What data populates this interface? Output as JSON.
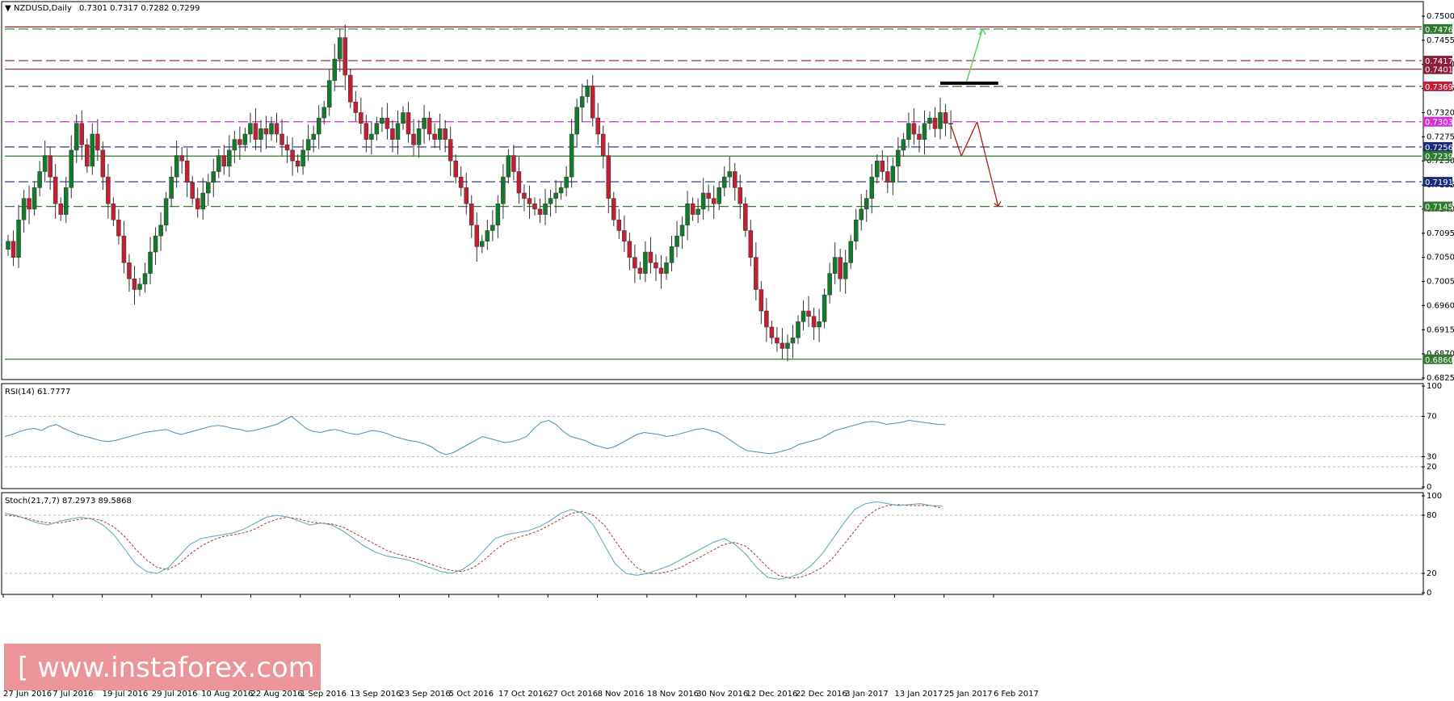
{
  "header": {
    "title": "NZDUSD,Daily",
    "ohlc": "0.7301 0.7317 0.7282 0.7299"
  },
  "rsi_panel": {
    "label": "RSI(14) 61.7777",
    "levels": [
      100,
      70,
      30,
      20,
      0
    ],
    "tick_labels": [
      "100",
      "70",
      "30",
      "20",
      "0"
    ]
  },
  "stoch_panel": {
    "label": "Stoch(21,7,7) 87.2973 89.5868",
    "levels": [
      100,
      80,
      20,
      0
    ],
    "tick_labels": [
      "100",
      "80",
      "20",
      "0"
    ]
  },
  "watermark": {
    "text": "[ www.instaforex.com ]"
  },
  "colors": {
    "bull": "#127a2a",
    "bear": "#c21f35",
    "wick": "#333333",
    "rsi": "#4b8fb3",
    "stoch_main": "#58a6b8",
    "stoch_signal": "#a63a3a",
    "magenta": "#d42fd4",
    "navy": "#1c2a7a",
    "dark_green": "#2e7a2e",
    "maroon": "#8a1e3a",
    "arrow_green": "#5fd05f",
    "arrow_red": "#b01c1c",
    "watermark_bg": "#e98a8f"
  },
  "chart_data": {
    "type": "candlestick",
    "symbol": "NZDUSD",
    "timeframe": "Daily",
    "ylim": [
      0.6825,
      0.75
    ],
    "y_ticks": [
      "0.7500",
      "0.7455",
      "0.7410",
      "0.7365",
      "0.7320",
      "0.7275",
      "0.7230",
      "0.7185",
      "0.7140",
      "0.7095",
      "0.7050",
      "0.7005",
      "0.6960",
      "0.6915",
      "0.6870",
      "0.6825"
    ],
    "x_tick_labels": [
      "27 Jun 2016",
      "7 Jul 2016",
      "19 Jul 2016",
      "29 Jul 2016",
      "10 Aug 2016",
      "22 Aug 2016",
      "1 Sep 2016",
      "13 Sep 2016",
      "23 Sep 2016",
      "5 Oct 2016",
      "17 Oct 2016",
      "27 Oct 2016",
      "8 Nov 2016",
      "18 Nov 2016",
      "30 Nov 2016",
      "12 Dec 2016",
      "22 Dec 2016",
      "3 Jan 2017",
      "13 Jan 2017",
      "25 Jan 2017",
      "6 Feb 2017"
    ],
    "closes": [
      0.708,
      0.705,
      0.712,
      0.716,
      0.714,
      0.718,
      0.721,
      0.724,
      0.72,
      0.715,
      0.713,
      0.718,
      0.725,
      0.73,
      0.726,
      0.722,
      0.728,
      0.725,
      0.72,
      0.715,
      0.712,
      0.709,
      0.704,
      0.701,
      0.699,
      0.7,
      0.702,
      0.706,
      0.709,
      0.711,
      0.716,
      0.72,
      0.724,
      0.723,
      0.719,
      0.716,
      0.714,
      0.717,
      0.719,
      0.721,
      0.724,
      0.722,
      0.725,
      0.727,
      0.726,
      0.728,
      0.73,
      0.727,
      0.729,
      0.728,
      0.73,
      0.728,
      0.726,
      0.725,
      0.723,
      0.722,
      0.725,
      0.727,
      0.728,
      0.731,
      0.733,
      0.738,
      0.742,
      0.746,
      0.739,
      0.734,
      0.732,
      0.73,
      0.727,
      0.728,
      0.73,
      0.731,
      0.729,
      0.727,
      0.73,
      0.732,
      0.728,
      0.726,
      0.729,
      0.731,
      0.728,
      0.727,
      0.729,
      0.727,
      0.723,
      0.72,
      0.718,
      0.715,
      0.711,
      0.707,
      0.708,
      0.71,
      0.711,
      0.715,
      0.72,
      0.724,
      0.721,
      0.717,
      0.716,
      0.715,
      0.714,
      0.713,
      0.715,
      0.716,
      0.717,
      0.718,
      0.72,
      0.728,
      0.733,
      0.735,
      0.737,
      0.731,
      0.728,
      0.724,
      0.716,
      0.712,
      0.71,
      0.708,
      0.705,
      0.703,
      0.702,
      0.706,
      0.704,
      0.703,
      0.702,
      0.704,
      0.707,
      0.709,
      0.711,
      0.715,
      0.713,
      0.714,
      0.717,
      0.716,
      0.715,
      0.718,
      0.72,
      0.721,
      0.718,
      0.715,
      0.71,
      0.705,
      0.699,
      0.695,
      0.692,
      0.69,
      0.689,
      0.688,
      0.689,
      0.69,
      0.693,
      0.695,
      0.694,
      0.692,
      0.693,
      0.698,
      0.702,
      0.705,
      0.701,
      0.704,
      0.708,
      0.712,
      0.714,
      0.716,
      0.72,
      0.723,
      0.721,
      0.719,
      0.722,
      0.725,
      0.727,
      0.73,
      0.728,
      0.727,
      0.73,
      0.731,
      0.729,
      0.732,
      0.73,
      0.7299
    ],
    "horizontal_levels": [
      {
        "price": 0.7476,
        "label": "0.7476",
        "style": "dashed",
        "color": "dark_green",
        "label_bg": "dark_green"
      },
      {
        "price": 0.748,
        "label": "",
        "style": "solid",
        "color": "maroon"
      },
      {
        "price": 0.7417,
        "label": "0.7417",
        "style": "dashed",
        "color": "maroon",
        "label_bg": "maroon"
      },
      {
        "price": 0.7401,
        "label": "0.7401",
        "style": "solid",
        "color": "maroon",
        "label_bg": "maroon"
      },
      {
        "price": 0.7369,
        "label": "0.7369",
        "style": "dashed",
        "color": "wick",
        "label_bg": "bear"
      },
      {
        "price": 0.7303,
        "label": "0.7303",
        "style": "dashed",
        "color": "magenta",
        "label_bg": "magenta"
      },
      {
        "price": 0.7256,
        "label": "0.7256",
        "style": "dashed",
        "color": "navy",
        "label_bg": "navy"
      },
      {
        "price": 0.7239,
        "label": "0.7239",
        "style": "solid",
        "color": "dark_green",
        "label_bg": "dark_green"
      },
      {
        "price": 0.7191,
        "label": "0.7191",
        "style": "dashed",
        "color": "navy",
        "label_bg": "navy"
      },
      {
        "price": 0.7145,
        "label": "0.7145",
        "style": "dashed",
        "color": "dark_green",
        "label_bg": "dark_green"
      },
      {
        "price": 0.686,
        "label": "0.6860",
        "style": "solid",
        "color": "dark_green",
        "label_bg": "dark_green"
      }
    ],
    "resistance_bar": {
      "price": 0.7375,
      "from_index": 177,
      "to_index": 188
    },
    "projection_up": {
      "from": {
        "i": 182,
        "price": 0.7378
      },
      "to": {
        "i": 185,
        "price": 0.7476
      }
    },
    "projection_down": [
      {
        "i": 179,
        "price": 0.7297
      },
      {
        "i": 181,
        "price": 0.7239
      },
      {
        "i": 184,
        "price": 0.7303
      },
      {
        "i": 188,
        "price": 0.7145
      }
    ],
    "rsi": [
      50,
      52,
      55,
      57,
      58,
      56,
      60,
      62,
      58,
      55,
      52,
      50,
      48,
      46,
      45,
      46,
      48,
      50,
      52,
      54,
      55,
      56,
      57,
      54,
      52,
      54,
      56,
      58,
      60,
      61,
      60,
      58,
      57,
      55,
      56,
      58,
      60,
      62,
      66,
      70,
      64,
      58,
      55,
      54,
      56,
      57,
      55,
      53,
      52,
      54,
      56,
      55,
      53,
      50,
      48,
      46,
      45,
      43,
      40,
      35,
      32,
      34,
      38,
      42,
      46,
      50,
      48,
      46,
      44,
      45,
      47,
      50,
      58,
      64,
      66,
      62,
      55,
      50,
      48,
      46,
      42,
      40,
      38,
      40,
      44,
      48,
      52,
      54,
      53,
      52,
      50,
      51,
      53,
      55,
      57,
      58,
      56,
      54,
      50,
      45,
      40,
      36,
      35,
      34,
      33,
      34,
      36,
      38,
      42,
      44,
      46,
      48,
      52,
      56,
      58,
      60,
      62,
      64,
      65,
      64,
      62,
      63,
      64,
      66,
      65,
      64,
      63,
      62,
      61.78
    ],
    "stoch_main": [
      82,
      80,
      76,
      72,
      70,
      74,
      76,
      78,
      76,
      70,
      60,
      45,
      30,
      22,
      20,
      26,
      38,
      50,
      56,
      58,
      60,
      62,
      66,
      72,
      78,
      80,
      78,
      74,
      70,
      72,
      70,
      64,
      56,
      48,
      42,
      38,
      36,
      34,
      30,
      26,
      22,
      20,
      24,
      32,
      44,
      56,
      60,
      62,
      64,
      68,
      74,
      82,
      86,
      82,
      70,
      50,
      30,
      20,
      18,
      20,
      24,
      28,
      34,
      40,
      46,
      52,
      56,
      50,
      40,
      26,
      16,
      14,
      16,
      20,
      28,
      40,
      56,
      72,
      86,
      92,
      94,
      92,
      90,
      91,
      92,
      90,
      89.59
    ],
    "stoch_signal": [
      80,
      79,
      77,
      74,
      72,
      72,
      74,
      76,
      77,
      74,
      68,
      58,
      45,
      34,
      26,
      24,
      30,
      40,
      48,
      54,
      58,
      60,
      62,
      66,
      72,
      76,
      78,
      76,
      73,
      72,
      71,
      68,
      62,
      56,
      50,
      44,
      40,
      37,
      34,
      30,
      26,
      23,
      22,
      26,
      34,
      44,
      52,
      57,
      60,
      64,
      70,
      76,
      82,
      84,
      80,
      70,
      54,
      38,
      26,
      20,
      20,
      22,
      26,
      32,
      38,
      44,
      50,
      52,
      48,
      38,
      26,
      18,
      15,
      16,
      20,
      26,
      36,
      50,
      64,
      78,
      86,
      90,
      91,
      90,
      90,
      90,
      87.3
    ]
  }
}
